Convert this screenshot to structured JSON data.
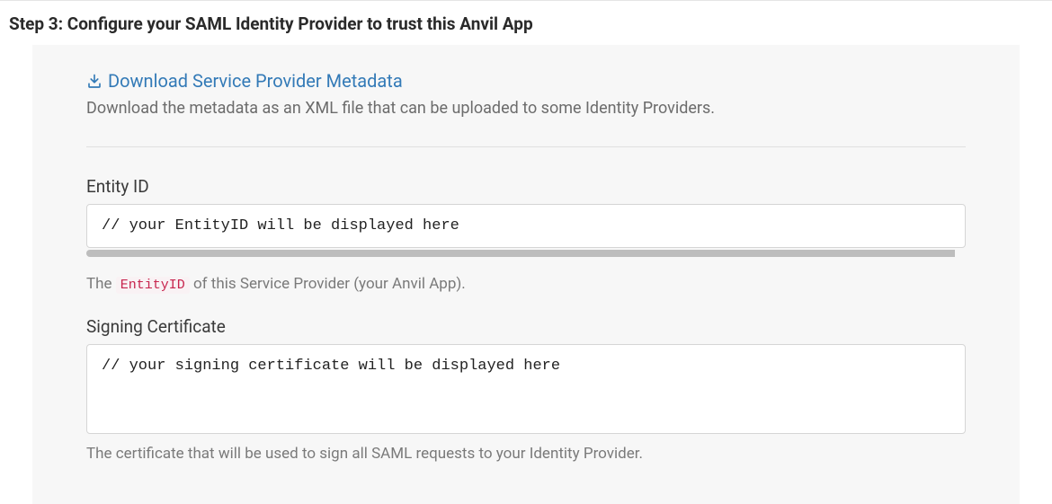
{
  "step": {
    "title": "Step 3: Configure your SAML Identity Provider to trust this Anvil App"
  },
  "download": {
    "link_text": "Download Service Provider Metadata",
    "description": "Download the metadata as an XML file that can be uploaded to some Identity Providers."
  },
  "entity_id": {
    "label": "Entity ID",
    "value": "// your EntityID will be displayed here",
    "help_prefix": "The ",
    "help_code": "EntityID",
    "help_suffix": " of this Service Provider (your Anvil App)."
  },
  "signing_cert": {
    "label": "Signing Certificate",
    "value": "// your signing certificate will be displayed here",
    "help": "The certificate that will be used to sign all SAML requests to your Identity Provider."
  }
}
